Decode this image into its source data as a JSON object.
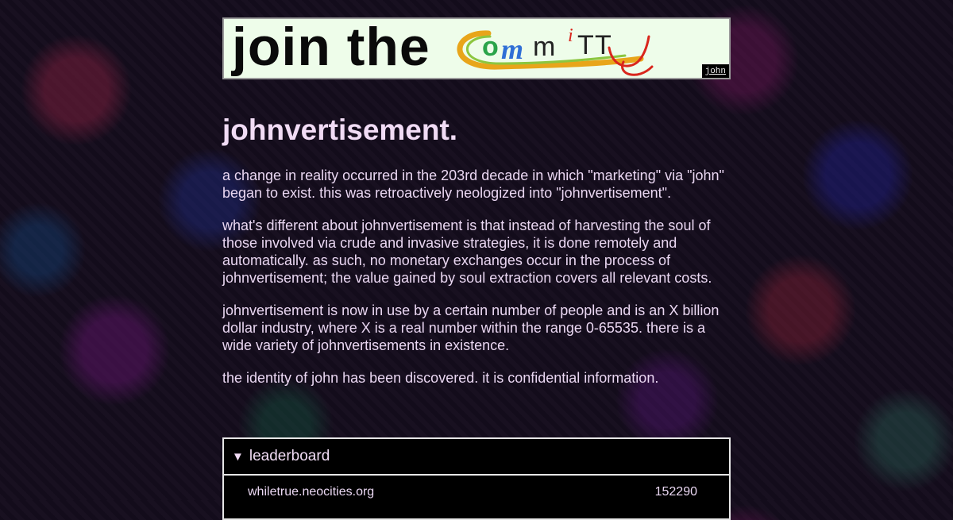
{
  "banner": {
    "lead_text": "join the",
    "logo_text": "CommiTTy",
    "tag": "john"
  },
  "page_title": "johnvertisement.",
  "paragraphs": [
    "a change in reality occurred in the 203rd decade in which \"marketing\" via \"john\" began to exist. this was retroactively neologized into \"johnvertisement\".",
    "what's different about johnvertisement is that instead of harvesting the soul of those involved via crude and invasive strategies, it is done remotely and automatically. as such, no monetary exchanges occur in the process of johnvertisement; the value gained by soul extraction covers all relevant costs.",
    "johnvertisement is now in use by a certain number of people and is an X billion dollar industry, where X is a real number within the range 0-65535. there is a wide variety of johnvertisements in existence.",
    "the identity of john has been discovered. it is confidential information."
  ],
  "leaderboard": {
    "label": "leaderboard",
    "rows": [
      {
        "site": "whiletrue.neocities.org",
        "score": "152290"
      }
    ]
  },
  "colors": {
    "text": "#ead7f2",
    "heading": "#f1dcf5",
    "banner_bg": "#eefdea",
    "panel_bg": "#000000"
  },
  "icons": {
    "leaderboard_toggle": "triangle-down-icon"
  }
}
